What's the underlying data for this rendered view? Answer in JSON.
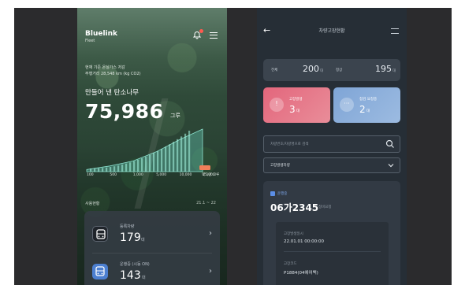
{
  "left_screen": {
    "app_name": "Bluelink",
    "app_sub": "Fleet",
    "summary_line_1": "현재 기준 온실가스 저감",
    "summary_line_2": "주행거리 28,548 km (kg CO2)",
    "tree_title": "만들어 낸 탄소나무",
    "tree_count": "75,986",
    "tree_unit": "그루",
    "chart_axis": [
      "100",
      "500",
      "1,000",
      "5,000",
      "10,000",
      "15,000"
    ],
    "chart_axis_end": "약 1만 그루",
    "history_label": "사용현황",
    "history_range": "21.1 ~ 22",
    "rows": [
      {
        "label": "등록차량",
        "count": "179",
        "unit": "대"
      },
      {
        "label": "운행중 (시동 ON)",
        "count": "143",
        "unit": "대"
      }
    ]
  },
  "chart_data": {
    "type": "area",
    "title": "",
    "x": [
      "100",
      "500",
      "1,000",
      "5,000",
      "10,000",
      "15,000"
    ],
    "series": [
      {
        "values": [
          3,
          8,
          15,
          28,
          45,
          60
        ]
      }
    ]
  },
  "right_screen": {
    "title": "차량고장현황",
    "stats": {
      "total_label": "전체",
      "total_value": "200",
      "total_unit": "대",
      "normal_label": "정상",
      "normal_value": "195",
      "normal_unit": "대"
    },
    "tiles": [
      {
        "label": "고장발생",
        "value": "3",
        "unit": "대",
        "icon": "alert-icon",
        "color": "#e3667c"
      },
      {
        "label": "점검 요청중",
        "value": "2",
        "unit": "대",
        "icon": "more-icon",
        "color": "#7fa5d6"
      }
    ],
    "search_placeholder": "차량번호/차량명으로 검색",
    "select_value": "고장발생차량",
    "vehicle": {
      "badge": "운행중",
      "number": "06가2345",
      "number_sub": "정비요청",
      "info": [
        {
          "label": "고장발생일시",
          "value": "22.01.01 00:00:00"
        },
        {
          "label": "고장코드",
          "value": "P1884(04에어백)"
        }
      ]
    }
  }
}
